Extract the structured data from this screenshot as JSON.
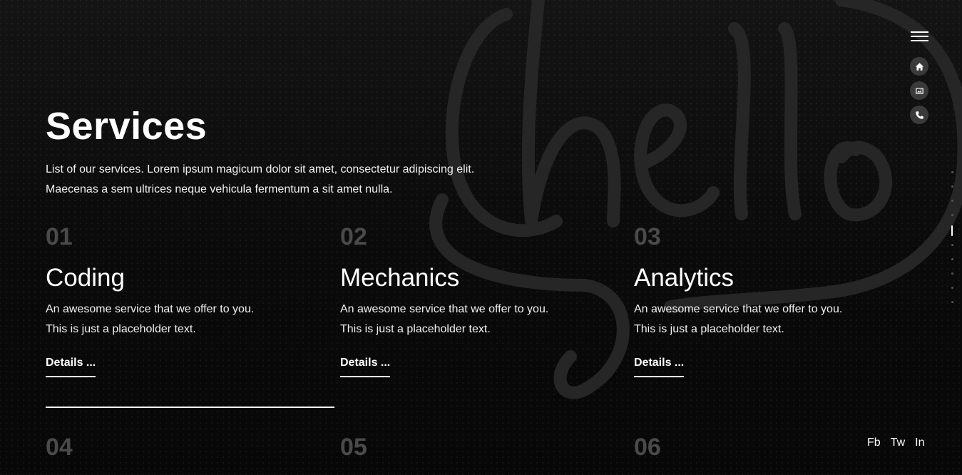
{
  "header": {
    "title": "Services",
    "intro": "List of our services. Lorem ipsum magicum dolor sit amet, consectetur adipiscing elit. Maecenas a sem ultrices neque vehicula fermentum a sit amet nulla."
  },
  "services": [
    {
      "number": "01",
      "name": "Coding",
      "line1": "An awesome service that we offer to you.",
      "line2": "This is just a placeholder text.",
      "link": "Details ..."
    },
    {
      "number": "02",
      "name": "Mechanics",
      "line1": "An awesome service that we offer to you.",
      "line2": "This is just a placeholder text.",
      "link": "Details ..."
    },
    {
      "number": "03",
      "name": "Analytics",
      "line1": "An awesome service that we offer to you.",
      "line2": "This is just a placeholder text.",
      "link": "Details ..."
    },
    {
      "number": "04"
    },
    {
      "number": "05"
    },
    {
      "number": "06"
    }
  ],
  "nav": {
    "menu_icon": "hamburger-menu-icon",
    "icons": [
      "home-icon",
      "gallery-icon",
      "phone-icon"
    ],
    "section_dots": 10,
    "active_dot": 4
  },
  "social": {
    "fb": "Fb",
    "tw": "Tw",
    "in": "In"
  },
  "colors": {
    "background": "#0b0b0b",
    "text": "#ffffff",
    "muted_number": "#4a4a4a",
    "nav_circle": "#3a3a3a"
  }
}
